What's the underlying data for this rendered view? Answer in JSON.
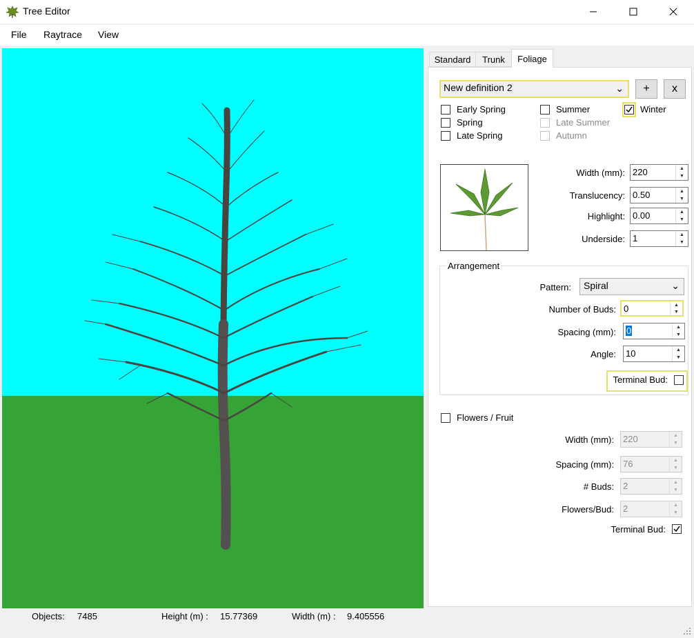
{
  "window": {
    "title": "Tree Editor",
    "minimize_icon": "minimize-icon",
    "maximize_icon": "maximize-icon",
    "close_icon": "close-icon"
  },
  "menu": [
    "File",
    "Raytrace",
    "View"
  ],
  "status": {
    "objects_label": "Objects:",
    "objects_value": "7485",
    "height_label": "Height (m) :",
    "height_value": "15.77369",
    "width_label": "Width (m) :",
    "width_value": "9.405556"
  },
  "tabs": [
    "Standard",
    "Trunk",
    "Foliage"
  ],
  "active_tab": "Foliage",
  "foliage": {
    "definition": "New definition 2",
    "add_label": "+",
    "remove_label": "x",
    "seasons": [
      {
        "label": "Early Spring",
        "checked": false,
        "enabled": true
      },
      {
        "label": "Spring",
        "checked": false,
        "enabled": true
      },
      {
        "label": "Late Spring",
        "checked": false,
        "enabled": true
      },
      {
        "label": "Summer",
        "checked": false,
        "enabled": true
      },
      {
        "label": "Late Summer",
        "checked": false,
        "enabled": false
      },
      {
        "label": "Autumn",
        "checked": false,
        "enabled": false
      },
      {
        "label": "Winter",
        "checked": true,
        "enabled": true
      }
    ],
    "leaf_image_icon": "leaf-icon",
    "width_label": "Width (mm):",
    "width_value": "220",
    "translucency_label": "Translucency:",
    "translucency_value": "0.50",
    "highlight_label": "Highlight:",
    "highlight_value": "0.00",
    "underside_label": "Underside:",
    "underside_value": "1"
  },
  "arrangement": {
    "title": "Arrangement",
    "pattern_label": "Pattern:",
    "pattern_value": "Spiral",
    "buds_label": "Number of Buds:",
    "buds_value": "0",
    "spacing_label": "Spacing (mm):",
    "spacing_value": "0",
    "angle_label": "Angle:",
    "angle_value": "10",
    "terminal_label": "Terminal Bud:"
  },
  "flowers": {
    "label": "Flowers / Fruit",
    "width_label": "Width (mm):",
    "width_value": "220",
    "spacing_label": "Spacing (mm):",
    "spacing_value": "76",
    "buds_label": "# Buds:",
    "buds_value": "2",
    "flowers_label": "Flowers/Bud:",
    "flowers_value": "2",
    "terminal_label": "Terminal Bud:"
  },
  "colors": {
    "sky": "#00ffff",
    "ground": "#36a336",
    "trunk": "#4a4440",
    "focus_highlight": "#e8e060"
  }
}
